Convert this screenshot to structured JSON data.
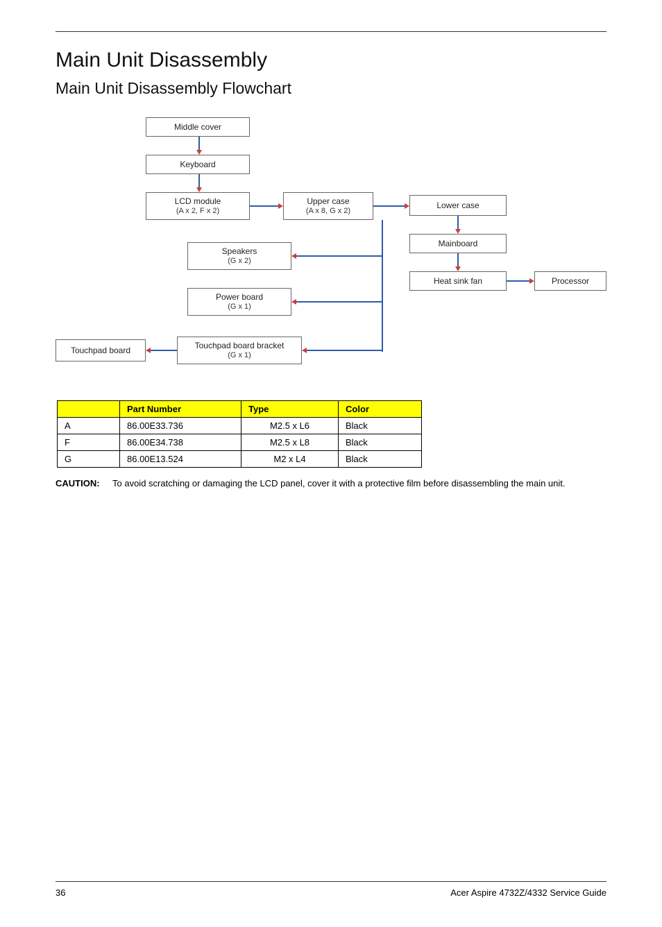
{
  "headings": {
    "title": "Main Unit Disassembly",
    "subtitle": "Main Unit Disassembly Flowchart"
  },
  "flowchart": {
    "nodes": {
      "middle_cover": {
        "label": "Middle cover"
      },
      "keyboard": {
        "label": "Keyboard"
      },
      "lcd_module": {
        "label": "LCD module",
        "sub": "(A x 2, F x 2)"
      },
      "upper_case": {
        "label": "Upper case",
        "sub": "(A x 8, G x 2)"
      },
      "lower_case": {
        "label": "Lower case"
      },
      "mainboard": {
        "label": "Mainboard"
      },
      "heat_sink_fan": {
        "label": "Heat sink fan"
      },
      "processor": {
        "label": "Processor"
      },
      "speakers": {
        "label": "Speakers",
        "sub": "(G x 2)"
      },
      "power_board": {
        "label": "Power board",
        "sub": "(G x 1)"
      },
      "touchpad_bracket": {
        "label": "Touchpad board bracket",
        "sub": "(G x 1)"
      },
      "touchpad_board": {
        "label": "Touchpad board"
      }
    }
  },
  "parts_table": {
    "headers": {
      "blank": "",
      "part_number": "Part Number",
      "type": "Type",
      "color": "Color"
    },
    "rows": [
      {
        "code": "A",
        "pn": "86.00E33.736",
        "type": "M2.5 x L6",
        "color": "Black"
      },
      {
        "code": "F",
        "pn": "86.00E34.738",
        "type": "M2.5 x L8",
        "color": "Black"
      },
      {
        "code": "G",
        "pn": "86.00E13.524",
        "type": "M2 x L4",
        "color": "Black"
      }
    ]
  },
  "caution": {
    "label": "CAUTION:",
    "text": "To avoid scratching or damaging the LCD panel, cover it with a protective film before disassembling the main unit."
  },
  "footer": {
    "page_number": "36",
    "doc_title": "Acer Aspire 4732Z/4332 Service Guide"
  },
  "chart_data": {
    "type": "diagram",
    "title": "Main Unit Disassembly Flowchart",
    "nodes": [
      {
        "id": "middle_cover",
        "label": "Middle cover"
      },
      {
        "id": "keyboard",
        "label": "Keyboard"
      },
      {
        "id": "lcd_module",
        "label": "LCD module",
        "annotation": "(A x 2, F x 2)"
      },
      {
        "id": "upper_case",
        "label": "Upper case",
        "annotation": "(A x 8, G x 2)"
      },
      {
        "id": "lower_case",
        "label": "Lower case"
      },
      {
        "id": "mainboard",
        "label": "Mainboard"
      },
      {
        "id": "heat_sink_fan",
        "label": "Heat sink fan"
      },
      {
        "id": "processor",
        "label": "Processor"
      },
      {
        "id": "speakers",
        "label": "Speakers",
        "annotation": "(G x 2)"
      },
      {
        "id": "power_board",
        "label": "Power board",
        "annotation": "(G x 1)"
      },
      {
        "id": "touchpad_bracket",
        "label": "Touchpad board bracket",
        "annotation": "(G x 1)"
      },
      {
        "id": "touchpad_board",
        "label": "Touchpad board"
      }
    ],
    "edges": [
      {
        "from": "middle_cover",
        "to": "keyboard"
      },
      {
        "from": "keyboard",
        "to": "lcd_module"
      },
      {
        "from": "lcd_module",
        "to": "upper_case"
      },
      {
        "from": "upper_case",
        "to": "lower_case"
      },
      {
        "from": "lower_case",
        "to": "mainboard"
      },
      {
        "from": "mainboard",
        "to": "heat_sink_fan"
      },
      {
        "from": "heat_sink_fan",
        "to": "processor"
      },
      {
        "from": "upper_case",
        "to": "speakers"
      },
      {
        "from": "upper_case",
        "to": "power_board"
      },
      {
        "from": "upper_case",
        "to": "touchpad_bracket"
      },
      {
        "from": "touchpad_bracket",
        "to": "touchpad_board"
      }
    ]
  }
}
